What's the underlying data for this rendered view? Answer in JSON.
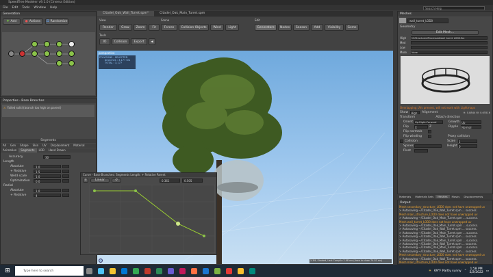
{
  "app": {
    "title": "SpeedTree Modeler v9.1.0 (Cinema Edition)",
    "menu": [
      "File",
      "Edit",
      "Tools",
      "Window",
      "Help"
    ],
    "search_placeholder": "Search Help"
  },
  "doc_tabs": [
    "Citadel_Oak_Wall_Turret.spm*",
    "Citadel_Oak_Main_Turret.spm"
  ],
  "generation": {
    "title": "Generation",
    "add": "Add",
    "actions": "Actions",
    "randomize": "Randomize"
  },
  "properties": {
    "title": "Properties - Base Branches",
    "message": "Failed solid (branch too high on parent)"
  },
  "segments": {
    "section": "Segments",
    "tabs": [
      "All",
      "Gen",
      "Shape",
      "Skin",
      "UV",
      "Displacement",
      "Material"
    ],
    "tabs2": [
      "Animation",
      "Segments",
      "LOD",
      "Hand Drawn"
    ],
    "accuracy_label": "Accuracy",
    "accuracy_value": "30",
    "length_header": "Length",
    "rows": [
      {
        "label": "Absolute",
        "value": "1.0"
      },
      {
        "label": "+ Relative",
        "value": "1.5"
      },
      {
        "label": "Weld scale",
        "value": "1.0"
      },
      {
        "label": "Optimization",
        "value": "0.0"
      }
    ],
    "radial_header": "Radial",
    "radial_rows": [
      {
        "label": "Absolute",
        "value": "1.0"
      },
      {
        "label": "+ Relative",
        "value": "4"
      }
    ]
  },
  "toolbar": {
    "view_label": "View",
    "scene_label": "Scene",
    "edit_label": "Edit",
    "tools_label": "Tools",
    "view_buttons": [
      "Render",
      "Grow",
      "Zoom",
      "Fit"
    ],
    "scene_buttons": [
      "Forces",
      "Collision Objects",
      "Wind",
      "Light"
    ],
    "edit_buttons": [
      "Generators",
      "Nodes",
      "Season",
      "Add",
      "Visibility",
      "Gems"
    ],
    "tools_buttons": [
      "IO",
      "Collision",
      "Export"
    ]
  },
  "viewport": {
    "label": "perspective",
    "poly_header": "POLYGONS : SELECTED",
    "poly_line1": "branches : 3,177 tris",
    "poly_line2": "TOTAL : 3,177",
    "status": "3.3M, Shaded, Last Compile 2.98 ms (draw to draw 74.02 ms)"
  },
  "curve": {
    "title": "Curve - Base Branches: Segments Length: + Relative Parent",
    "preset": "Linear",
    "field1": "0.361",
    "field2": "0.505"
  },
  "meshes": {
    "title": "Meshes",
    "mesh_name": "wall_turret_LOD0",
    "geometry_label": "Geometry",
    "edit_mesh": "Edit Mesh...",
    "lod_rows": [
      {
        "label": "High",
        "value": "M:/Structures/Processed/wall_turret_LOD0.fbx"
      },
      {
        "label": "Med",
        "value": ""
      },
      {
        "label": "Low",
        "value": ""
      },
      {
        "label": "More",
        "value": "None"
      }
    ],
    "warning": "Overlapping UVs present, will not work with Lightmaps",
    "show_label": "Show",
    "show_value": "High",
    "alignment_label": "Alignment",
    "dims": "H: 0.8844 W: 0.65516",
    "transform_label": "Transform",
    "attach_label": "Attach direction",
    "orient_label": "Orient",
    "orient_value": "Up-Right-Forward",
    "growth_label": "Growth",
    "growth_value": "Up",
    "flip_label": "Flip",
    "flip_value": "X",
    "z": "Z",
    "ripple_label": "Ripple",
    "ripple_value": "Normal",
    "flip_normals": "Flip normals",
    "flip_winding": "Flip winding",
    "collision_label": "Collision",
    "proxy_label": "Proxy collision",
    "scale_label": "Scale",
    "scale_value": "1",
    "spines_label": "Spines",
    "pivot_label": "Pivot",
    "height_label": "Height",
    "height_value": "0"
  },
  "right_tabs": [
    "Materials",
    "Materials Sets",
    "Meshes",
    "Masks",
    "Displacements"
  ],
  "output": {
    "title": "Output",
    "lines": [
      "Mesh secondary_structure_LOD0 does not have unwrapped uv",
      "> Autosaving ~/Citadel_Oak_Wall_Turret.spm ... success.",
      "Mesh main_structure_LOD0 does not have unwrapped uv",
      "> Autosaving ~/Citadel_Oak_Main_Turret.spm ... success.",
      "Mesh wall_turret_LOD0 does not have unwrapped uv",
      "> Autosaving ~/Citadel_Oak_Main_Turret.spm ... success.",
      "> Autosaving ~/Citadel_Oak_Wall_Turret.spm ... success.",
      "> Autosaving ~/Citadel_Oak_Main_Turret.spm ... success.",
      "> Autosaving ~/Citadel_Oak_Wall_Turret.spm ... success.",
      "> Autosaving ~/Citadel_Oak_Main_Turret.spm ... success.",
      "> Autosaving ~/Citadel_Oak_Wall_Turret.spm ... success.",
      "> Autosaving ~/Citadel_Oak_Main_Turret.spm ... success.",
      "> Autosaving ~/Citadel_Oak_Wall_Turret.spm ... success.",
      "Mesh secondary_structure_LOD0 does not have unwrapped uv",
      "> Autosaving ~/Citadel_Oak_Wall_Turret.spm ... success.",
      "Mesh main_structure_LOD0 does not have unwrapped uv",
      "> Autosaving ~/Citadel_Oak_Main_Turret.spm ... success."
    ]
  },
  "taskbar": {
    "search_placeholder": "Type here to search",
    "weather": "69°F Partly sunny",
    "time": "1:58 PM",
    "date": "5/2/2022"
  },
  "colors": {
    "accent": "#e8a030",
    "warning": "#e07a2a",
    "node_green": "#8bc34a",
    "curve_line": "#9acd32"
  }
}
